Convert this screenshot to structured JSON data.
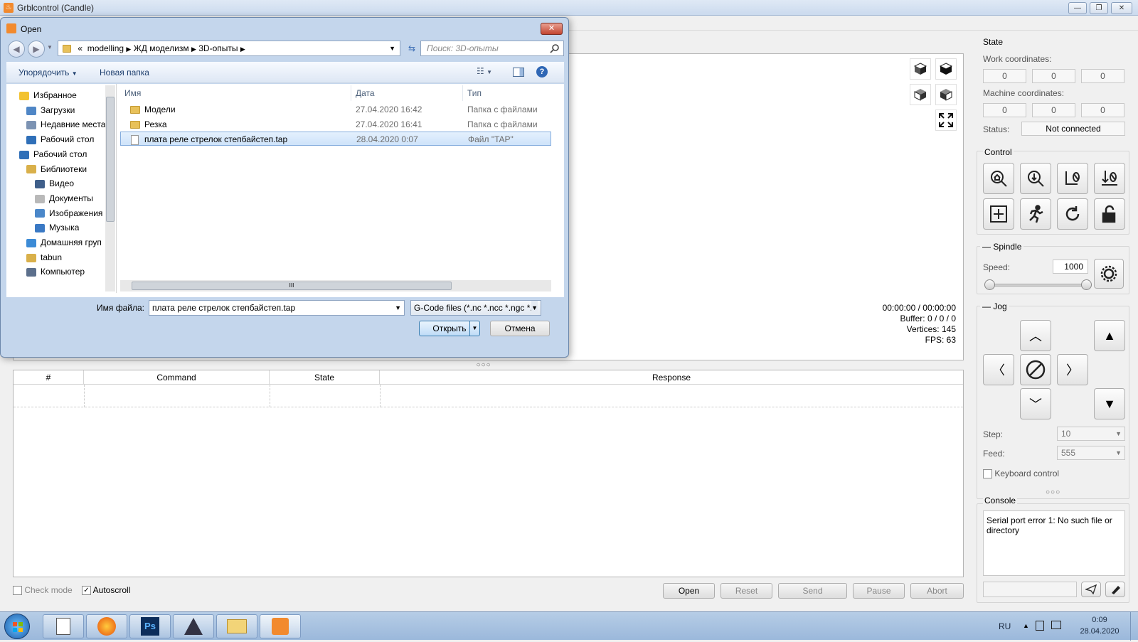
{
  "app": {
    "title": "Grblcontrol  (Candle)",
    "window_buttons": [
      "—",
      "❐",
      "✕"
    ]
  },
  "viewer": {
    "time": "00:00:00 / 00:00:00",
    "buffer": "Buffer: 0 / 0 / 0",
    "vertices": "Vertices: 145",
    "fps": "FPS: 63"
  },
  "table": {
    "columns": [
      "#",
      "Command",
      "State",
      "Response"
    ]
  },
  "bottom": {
    "check_mode": "Check mode",
    "autoscroll": "Autoscroll",
    "autoscroll_checked": true,
    "buttons": {
      "open": "Open",
      "reset": "Reset",
      "send": "Send",
      "pause": "Pause",
      "abort": "Abort"
    }
  },
  "state": {
    "title": "State",
    "work_label": "Work coordinates:",
    "work": [
      "0",
      "0",
      "0"
    ],
    "machine_label": "Machine coordinates:",
    "machine": [
      "0",
      "0",
      "0"
    ],
    "status_label": "Status:",
    "status": "Not connected"
  },
  "control": {
    "title": "Control"
  },
  "spindle": {
    "title": "Spindle",
    "speed_label": "Speed:",
    "speed": "1000",
    "level": 1.0
  },
  "jog": {
    "title": "Jog",
    "step_label": "Step:",
    "step": "10",
    "feed_label": "Feed:",
    "feed": "555",
    "keyboard": "Keyboard control"
  },
  "console": {
    "title": "Console",
    "text": "Serial port error 1: No such file or directory"
  },
  "dialog": {
    "title": "Open",
    "path": [
      "«",
      "modelling",
      "ЖД моделизм",
      "3D-опыты"
    ],
    "search_placeholder": "Поиск: 3D-опыты",
    "organize": "Упорядочить",
    "new_folder": "Новая папка",
    "nav": [
      {
        "label": "Избранное",
        "level": 0,
        "icon": "star-icon",
        "color": "#f2c230"
      },
      {
        "label": "Загрузки",
        "level": 1,
        "icon": "downloads-icon",
        "color": "#4f86c6"
      },
      {
        "label": "Недавние места",
        "level": 1,
        "icon": "recent-places-icon",
        "color": "#7c93b3"
      },
      {
        "label": "Рабочий стол",
        "level": 1,
        "icon": "desktop-icon",
        "color": "#2f6fb8"
      },
      {
        "label": "Рабочий стол",
        "level": 0,
        "icon": "desktop-icon",
        "color": "#2f6fb8"
      },
      {
        "label": "Библиотеки",
        "level": 1,
        "icon": "libraries-icon",
        "color": "#d9b04a"
      },
      {
        "label": "Видео",
        "level": 2,
        "icon": "video-icon",
        "color": "#3f5f8a"
      },
      {
        "label": "Документы",
        "level": 2,
        "icon": "documents-icon",
        "color": "#b9b9b9"
      },
      {
        "label": "Изображения",
        "level": 2,
        "icon": "images-icon",
        "color": "#4a87c9"
      },
      {
        "label": "Музыка",
        "level": 2,
        "icon": "music-icon",
        "color": "#3a79c4"
      },
      {
        "label": "Домашняя груп",
        "level": 1,
        "icon": "homegroup-icon",
        "color": "#3c8bd6"
      },
      {
        "label": "tabun",
        "level": 1,
        "icon": "user-folder-icon",
        "color": "#d9b04a"
      },
      {
        "label": "Компьютер",
        "level": 1,
        "icon": "computer-icon",
        "color": "#5c6f8c"
      }
    ],
    "columns": {
      "name": "Имя",
      "date": "Дата",
      "type": "Тип"
    },
    "files": [
      {
        "name": "Модели",
        "date": "27.04.2020 16:42",
        "type": "Папка с файлами",
        "kind": "folder",
        "selected": false
      },
      {
        "name": "Резка",
        "date": "27.04.2020 16:41",
        "type": "Папка с файлами",
        "kind": "folder",
        "selected": false
      },
      {
        "name": "плата реле стрелок степбайстеп.tap",
        "date": "28.04.2020 0:07",
        "type": "Файл \"TAP\"",
        "kind": "file",
        "selected": true
      }
    ],
    "filename_label": "Имя файла:",
    "filename": "плата реле стрелок степбайстеп.tap",
    "filter": "G-Code files (*.nc *.ncc *.ngc *.",
    "open_button": "Открыть",
    "cancel_button": "Отмена"
  },
  "taskbar": {
    "lang": "RU",
    "time": "0:09",
    "date": "28.04.2020",
    "apps": [
      "notepad-icon",
      "firefox-icon",
      "photoshop-icon",
      "cad-icon",
      "explorer-icon",
      "candle-icon"
    ],
    "ps_label": "Ps"
  }
}
